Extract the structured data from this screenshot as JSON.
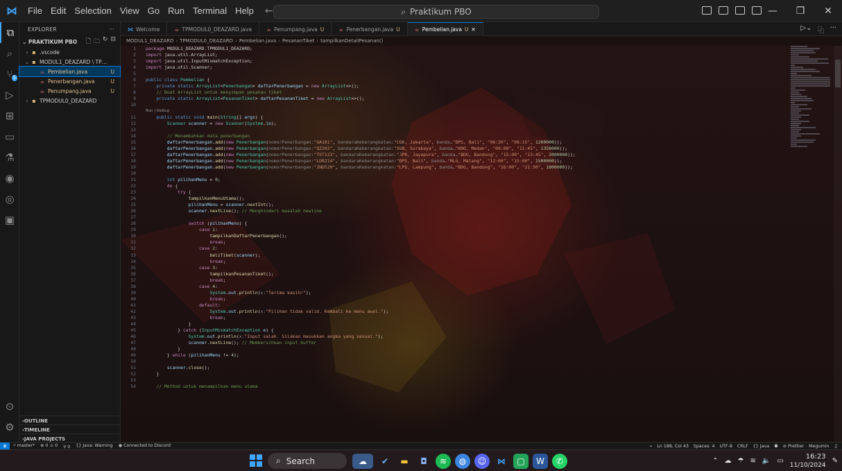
{
  "titlebar": {
    "menu": [
      "File",
      "Edit",
      "Selection",
      "View",
      "Go",
      "Run",
      "Terminal",
      "Help"
    ],
    "search_text": "Praktikum PBO"
  },
  "sidebar": {
    "header": "EXPLORER",
    "project": "PRAKTIKUM PBO",
    "tree": [
      {
        "label": ".vscode",
        "status": "",
        "depth": 0,
        "arrow": "›",
        "icon": "folder-icon"
      },
      {
        "label": "MODUL1_DEAZARD \\ TPM...",
        "status": "",
        "depth": 0,
        "arrow": "⌄",
        "icon": "folder-icon"
      },
      {
        "label": "Pembelian.java",
        "status": "U",
        "depth": 1,
        "arrow": "",
        "icon": "java-icon",
        "selected": true
      },
      {
        "label": "Penerbangan.java",
        "status": "U",
        "depth": 1,
        "arrow": "",
        "icon": "java-icon"
      },
      {
        "label": "Penumpang.java",
        "status": "U",
        "depth": 1,
        "arrow": "",
        "icon": "java-icon"
      },
      {
        "label": "TPMODUL0_DEAZARD",
        "status": "",
        "depth": 0,
        "arrow": "›",
        "icon": "folder-icon"
      }
    ],
    "outline": "OUTLINE",
    "timeline": "TIMELINE",
    "java_projects": "JAVA PROJECTS"
  },
  "tabs": [
    {
      "label": "Welcome",
      "mod": "",
      "active": false,
      "icon": "vscode"
    },
    {
      "label": "TPMODUL0_DEAZARD.java",
      "mod": "",
      "active": false,
      "icon": "java"
    },
    {
      "label": "Penumpang.java",
      "mod": "U",
      "active": false,
      "icon": "java"
    },
    {
      "label": "Penerbangan.java",
      "mod": "U",
      "active": false,
      "icon": "java"
    },
    {
      "label": "Pembelian.java",
      "mod": "U",
      "active": true,
      "icon": "java"
    }
  ],
  "breadcrumb": [
    "MODUL1_DEAZARD",
    "TPMODUL0_DEAZARD",
    "Pembelian.java",
    "PesananTiket",
    "tampilkanDetailPesanan()"
  ],
  "code": [
    {
      "n": "1",
      "h": "<span class='k'>package</span> MODUL1_DEAZARD.TPMODUL1_DEAZARD;"
    },
    {
      "n": "2",
      "h": "<span class='k'>import</span> java.util.ArrayList;"
    },
    {
      "n": "3",
      "h": "<span class='k'>import</span> java.util.InputMismatchException;"
    },
    {
      "n": "4",
      "h": "<span class='k'>import</span> java.util.Scanner;"
    },
    {
      "n": "5",
      "h": ""
    },
    {
      "n": "6",
      "h": "<span class='kw'>public class</span> <span class='ty'>Pembelian</span> {"
    },
    {
      "n": "7",
      "h": "    <span class='kw'>private static</span> <span class='ty'>ArrayList</span>&lt;<span class='ty'>Penerbangan</span>&gt; <span class='va'>daftarPenerbangan</span> = <span class='k'>new</span> <span class='ty'>ArrayList</span>&lt;&gt;();"
    },
    {
      "n": "8",
      "h": "    <span class='cm'>// Buat ArrayList untuk menyimpan pesanan tiket</span>"
    },
    {
      "n": "9",
      "h": "    <span class='kw'>private static</span> <span class='ty'>ArrayList</span>&lt;<span class='ty'>PesananTiket</span>&gt; <span class='va'>daftarPesananTiket</span> = <span class='k'>new</span> <span class='ty'>ArrayList</span>&lt;&gt;();"
    },
    {
      "n": "10",
      "h": ""
    },
    {
      "n": "",
      "lens": true,
      "h": "Run | Debug"
    },
    {
      "n": "11",
      "h": "    <span class='kw'>public static void</span> <span class='fn'>main</span>(<span class='ty'>String</span>[] <span class='va'>args</span>) {"
    },
    {
      "n": "12",
      "h": "        <span class='ty'>Scanner</span> <span class='va'>scanner</span> = <span class='k'>new</span> <span class='ty'>Scanner</span>(<span class='ty'>System</span>.<span class='va'>in</span>);"
    },
    {
      "n": "13",
      "h": ""
    },
    {
      "n": "14",
      "h": "        <span class='cm'>// Menambahkan data penerbangan</span>"
    },
    {
      "n": "15",
      "h": "        <span class='va'>daftarPenerbangan</span>.<span class='fn'>add</span>(<span class='k'>new</span> <span class='ty'>Penerbangan</span>(<span class='hint'>nomorPenerbangan:</span><span class='st2'>\"GA101\"</span>, <span class='hint'>bandaraKeberangkatan:</span><span class='st2'>\"CGK, Jakarta\"</span>, <span class='hint'>banda…</span><span class='st2'>\"DPS, Bali\"</span>, <span class='st2'>\"06:30\"</span>, <span class='st2'>\"08:15\"</span>, <span class='nu'>1200000</span>));"
    },
    {
      "n": "16",
      "h": "        <span class='va'>daftarPenerbangan</span>.<span class='fn'>add</span>(<span class='k'>new</span> <span class='ty'>Penerbangan</span>(<span class='hint'>nomorPenerbangan:</span><span class='st2'>\"QZ202\"</span>, <span class='hint'>bandaraKeberangkatan:</span><span class='st2'>\"SUB, Surabaya\"</span>, <span class='hint'>banda…</span><span class='st2'>\"KNO, Medan\"</span>, <span class='st2'>\"09:00\"</span>, <span class='st2'>\"11:45\"</span>, <span class='nu'>1350000</span>));"
    },
    {
      "n": "17",
      "h": "        <span class='va'>daftarPenerbangan</span>.<span class='fn'>add</span>(<span class='k'>new</span> <span class='ty'>Penerbangan</span>(<span class='hint'>nomorPenerbangan:</span><span class='st2'>\"TST123\"</span>, <span class='hint'>bandaraKeberangkatan:</span><span class='st2'>\"JPR, Jayapura\"</span>, <span class='hint'>banda…</span><span class='st2'>\"BDG, Bandung\"</span>, <span class='st2'>\"15:00\"</span>, <span class='st2'>\"23:45\"</span>, <span class='nu'>2000000</span>));"
    },
    {
      "n": "18",
      "h": "        <span class='va'>daftarPenerbangan</span>.<span class='fn'>add</span>(<span class='k'>new</span> <span class='ty'>Penerbangan</span>(<span class='hint'>nomorPenerbangan:</span><span class='st2'>\"LDR214\"</span>, <span class='hint'>bandaraKeberangkatan:</span><span class='st2'>\"DPS, Bali\"</span>, <span class='hint'>banda…</span><span class='st2'>\"MLG, Malang\"</span>, <span class='st2'>\"12:00\"</span>, <span class='st2'>\"15:00\"</span>, <span class='nu'>1500000</span>));"
    },
    {
      "n": "19",
      "h": "        <span class='va'>daftarPenerbangan</span>.<span class='fn'>add</span>(<span class='k'>new</span> <span class='ty'>Penerbangan</span>(<span class='hint'>nomorPenerbangan:</span><span class='st2'>\"IND520\"</span>, <span class='hint'>bandaraKeberangkatan:</span><span class='st2'>\"LPG, Lampung\"</span>, <span class='hint'>banda…</span><span class='st2'>\"BDG, Bandung\"</span>, <span class='st2'>\"16:00\"</span>, <span class='st2'>\"21:30\"</span>, <span class='nu'>1800000</span>));"
    },
    {
      "n": "20",
      "h": ""
    },
    {
      "n": "21",
      "h": "        <span class='kw'>int</span> <span class='va'>pilihanMenu</span> = <span class='nu'>0</span>;"
    },
    {
      "n": "22",
      "h": "        <span class='k'>do</span> {"
    },
    {
      "n": "23",
      "h": "            <span class='k'>try</span> {"
    },
    {
      "n": "24",
      "h": "                <span class='fn'>tampilkanMenuUtama</span>();"
    },
    {
      "n": "25",
      "h": "                <span class='va'>pilihanMenu</span> = <span class='va'>scanner</span>.<span class='fn'>nextInt</span>();"
    },
    {
      "n": "26",
      "h": "                <span class='va'>scanner</span>.<span class='fn'>nextLine</span>(); <span class='cm'>// Menghindari masalah newline</span>"
    },
    {
      "n": "27",
      "h": ""
    },
    {
      "n": "28",
      "h": "                <span class='k'>switch</span> (<span class='va'>pilihanMenu</span>) {"
    },
    {
      "n": "29",
      "h": "                    <span class='k'>case</span> <span class='nu'>1</span>:"
    },
    {
      "n": "30",
      "h": "                        <span class='fn'>tampilkanDaftarPenerbangan</span>();"
    },
    {
      "n": "31",
      "h": "                        <span class='k'>break</span>;"
    },
    {
      "n": "32",
      "h": "                    <span class='k'>case</span> <span class='nu'>2</span>:"
    },
    {
      "n": "33",
      "h": "                        <span class='fn'>beliTiket</span>(<span class='va'>scanner</span>);"
    },
    {
      "n": "34",
      "h": "                        <span class='k'>break</span>;"
    },
    {
      "n": "35",
      "h": "                    <span class='k'>case</span> <span class='nu'>3</span>:"
    },
    {
      "n": "36",
      "h": "                        <span class='fn'>tampilkanPesananTiket</span>();"
    },
    {
      "n": "37",
      "h": "                        <span class='k'>break</span>;"
    },
    {
      "n": "38",
      "h": "                    <span class='k'>case</span> <span class='nu'>4</span>:"
    },
    {
      "n": "39",
      "h": "                        <span class='ty'>System</span>.<span class='va'>out</span>.<span class='fn'>println</span>(<span class='hint'>x:</span><span class='st2'>\"Terima kasih!\"</span>);"
    },
    {
      "n": "40",
      "h": "                        <span class='k'>break</span>;"
    },
    {
      "n": "41",
      "h": "                    <span class='k'>default</span>:"
    },
    {
      "n": "42",
      "h": "                        <span class='ty'>System</span>.<span class='va'>out</span>.<span class='fn'>println</span>(<span class='hint'>x:</span><span class='st2'>\"Pilihan tidak valid. Kembali ke menu awal.\"</span>);"
    },
    {
      "n": "43",
      "h": "                        <span class='k'>break</span>;"
    },
    {
      "n": "44",
      "h": "                }"
    },
    {
      "n": "45",
      "h": "            } <span class='k'>catch</span> (<span class='ty'>InputMismatchException</span> <span class='va'>e</span>) {"
    },
    {
      "n": "46",
      "h": "                <span class='ty'>System</span>.<span class='va'>out</span>.<span class='fn'>println</span>(<span class='hint'>x:</span><span class='st2'>\"Input salah. Silakan masukkan angka yang sesuai.\"</span>);"
    },
    {
      "n": "47",
      "h": "                <span class='va'>scanner</span>.<span class='fn'>nextLine</span>(); <span class='cm'>// Membersihkan input buffer</span>"
    },
    {
      "n": "48",
      "h": "            }"
    },
    {
      "n": "49",
      "h": "        } <span class='k'>while</span> (<span class='va'>pilihanMenu</span> != <span class='nu'>4</span>);"
    },
    {
      "n": "50",
      "h": ""
    },
    {
      "n": "51",
      "h": "        <span class='va'>scanner</span>.<span class='fn'>close</span>();"
    },
    {
      "n": "52",
      "h": "    }"
    },
    {
      "n": "53",
      "h": ""
    },
    {
      "n": "54",
      "h": "    <span class='cm'>// Method untuk menampilkan menu utama</span>"
    }
  ],
  "statusbar": {
    "branch": "master*",
    "sync": "⊗ 0 ⚠ 0",
    "ports": "⅌ 0",
    "java_status": "Java: Warning",
    "discord": "Connected to Discord",
    "position": "Ln 188, Col 43",
    "spaces": "Spaces: 4",
    "encoding": "UTF-8",
    "eol": "CRLF",
    "language": "{} Java",
    "prettier": "Prettier",
    "user": "Megumin"
  },
  "taskbar": {
    "search": "Search",
    "time": "16:23",
    "date": "11/10/2024"
  },
  "colors": {
    "accent": "#0078d4",
    "status_untracked": "#d7ba7d"
  }
}
